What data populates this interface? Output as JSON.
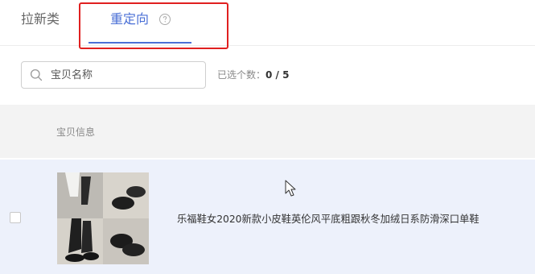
{
  "tabs": [
    {
      "label": "拉新类",
      "active": false
    },
    {
      "label": "重定向",
      "active": true
    }
  ],
  "search": {
    "placeholder": "宝贝名称",
    "value": ""
  },
  "selection": {
    "prefix": "已选个数：",
    "count": "0 / 5"
  },
  "table": {
    "headers": [
      "宝贝信息"
    ],
    "rows": [
      {
        "title": "乐福鞋女2020新款小皮鞋英伦风平底粗跟秋冬加绒日系防滑深口单鞋",
        "checked": false
      }
    ]
  },
  "icons": {
    "help": "help-circle-icon",
    "search": "search-icon",
    "cursor": "mouse-pointer-icon"
  },
  "colors": {
    "accent": "#4a6fd6",
    "highlight": "#e02020",
    "row_bg": "#edf1fb",
    "header_bg": "#f3f3f3"
  }
}
